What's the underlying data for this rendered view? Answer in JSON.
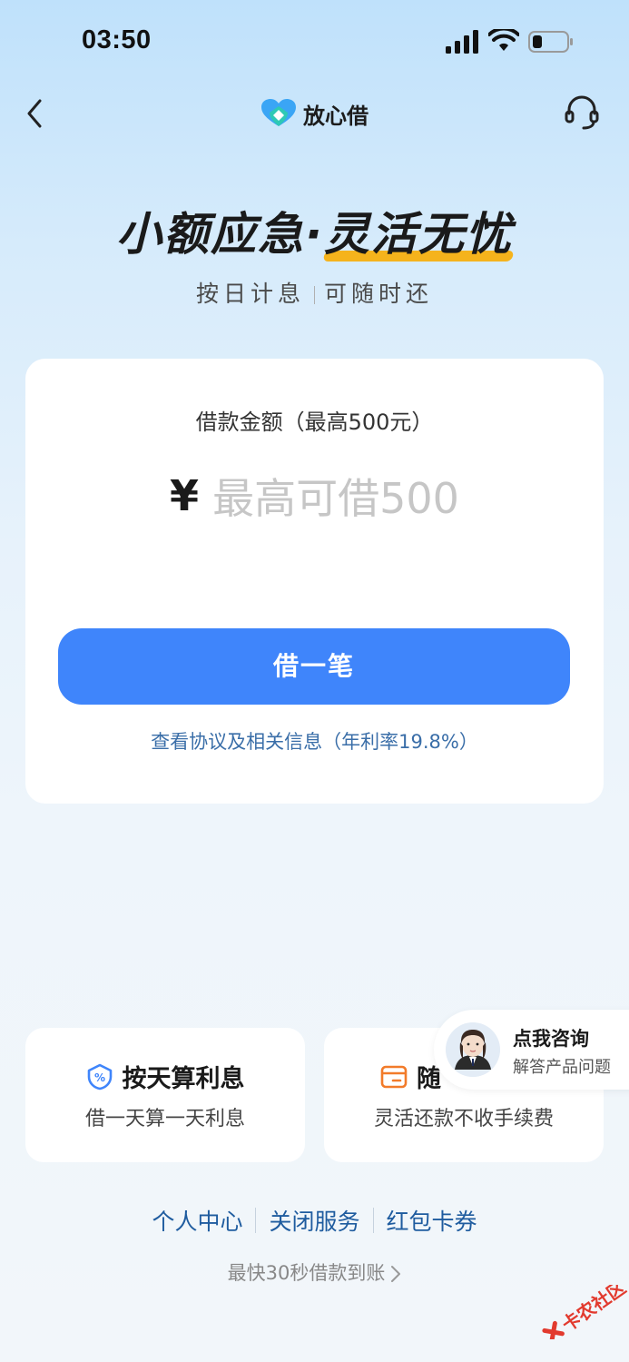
{
  "status_bar": {
    "time": "03:50",
    "signal_icon": "cellular-signal-icon",
    "wifi_icon": "wifi-icon",
    "battery_icon": "battery-low-icon"
  },
  "nav": {
    "brand_name": "放心借",
    "back_icon": "chevron-left-icon",
    "service_icon": "headset-icon"
  },
  "hero": {
    "title_part1": "小额应急·",
    "title_part2": "灵活无忧",
    "subtitle_left": "按日计息",
    "subtitle_right": "可随时还"
  },
  "loan_card": {
    "amount_label": "借款金额（最高500元）",
    "currency_symbol": "¥",
    "amount_placeholder": "最高可借500",
    "borrow_button": "借一笔",
    "agreement_link": "查看协议及相关信息（年利率19.8%）"
  },
  "features": [
    {
      "title": "按天算利息",
      "desc": "借一天算一天利息",
      "icon": "percent-shield-icon"
    },
    {
      "title": "随",
      "desc": "灵活还款不收手续费",
      "icon": "wallet-icon"
    }
  ],
  "consult": {
    "title": "点我咨询",
    "subtitle": "解答产品问题"
  },
  "bottom_links": [
    "个人中心",
    "关闭服务",
    "红包卡券"
  ],
  "fast_note": "最快30秒借款到账",
  "colors": {
    "primary": "#3f85fb",
    "link": "#1f5c9f",
    "accent_yellow": "#f5b31c",
    "watermark_red": "#e23a2e"
  }
}
